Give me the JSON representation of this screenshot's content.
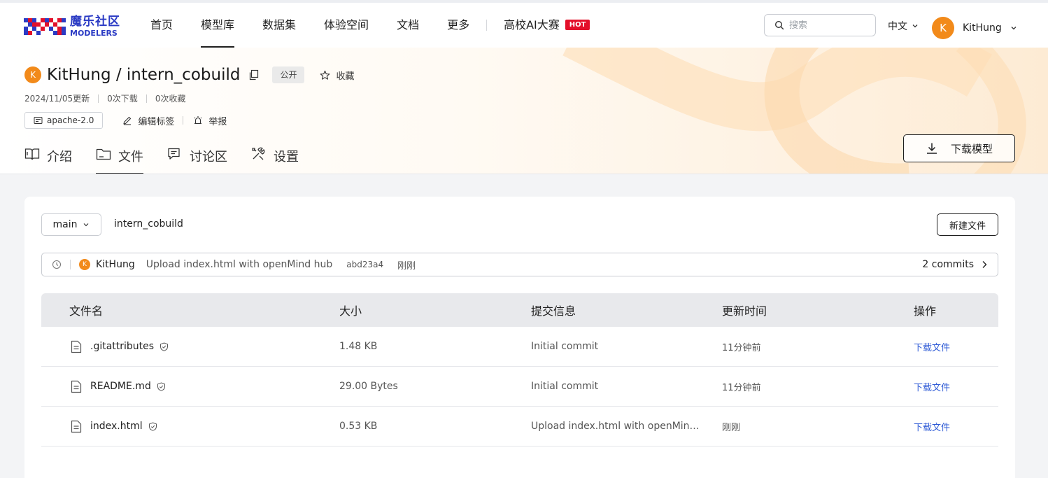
{
  "brand": {
    "name_cn": "魔乐社区",
    "name_en": "MODELERS"
  },
  "nav": {
    "items": [
      {
        "label": "首页",
        "active": false
      },
      {
        "label": "模型库",
        "active": true
      },
      {
        "label": "数据集",
        "active": false
      },
      {
        "label": "体验空间",
        "active": false
      },
      {
        "label": "文档",
        "active": false
      },
      {
        "label": "更多",
        "active": false
      }
    ],
    "contest_label": "高校AI大赛",
    "hot_badge": "HOT"
  },
  "search": {
    "placeholder": "搜索"
  },
  "language": {
    "label": "中文"
  },
  "user": {
    "avatar_letter": "K",
    "name": "KitHung"
  },
  "repo": {
    "avatar_letter": "K",
    "title": "KitHung / intern_cobuild",
    "visibility": "公开",
    "favorite_label": "收藏",
    "updated": "2024/11/05更新",
    "downloads": "0次下载",
    "favorites": "0次收藏",
    "license": "apache-2.0",
    "edit_tags_label": "编辑标签",
    "report_label": "举报",
    "download_model_label": "下载模型"
  },
  "tabs": [
    {
      "label": "介绍",
      "icon": "book-icon",
      "active": false
    },
    {
      "label": "文件",
      "icon": "folder-icon",
      "active": true
    },
    {
      "label": "讨论区",
      "icon": "chat-icon",
      "active": false
    },
    {
      "label": "设置",
      "icon": "tools-icon",
      "active": false
    }
  ],
  "files": {
    "branch": "main",
    "path": "intern_cobuild",
    "new_file_label": "新建文件",
    "last_commit": {
      "avatar_letter": "K",
      "author": "KitHung",
      "message": "Upload index.html with openMind hub",
      "hash": "abd23a4",
      "time": "刚刚",
      "commits_label": "2 commits"
    },
    "columns": [
      "文件名",
      "大小",
      "提交信息",
      "更新时间",
      "操作"
    ],
    "rows": [
      {
        "name": ".gitattributes",
        "size": "1.48 KB",
        "commit": "Initial commit",
        "updated": "11分钟前",
        "action": "下载文件"
      },
      {
        "name": "README.md",
        "size": "29.00 Bytes",
        "commit": "Initial commit",
        "updated": "11分钟前",
        "action": "下载文件"
      },
      {
        "name": "index.html",
        "size": "0.53 KB",
        "commit": "Upload index.html with openMind hub",
        "updated": "刚刚",
        "action": "下载文件"
      }
    ]
  },
  "colors": {
    "brand_blue": "#2b3bc4",
    "brand_red": "#e3102a",
    "avatar_orange": "#f28a1a",
    "link_blue": "#2f5bd6"
  }
}
